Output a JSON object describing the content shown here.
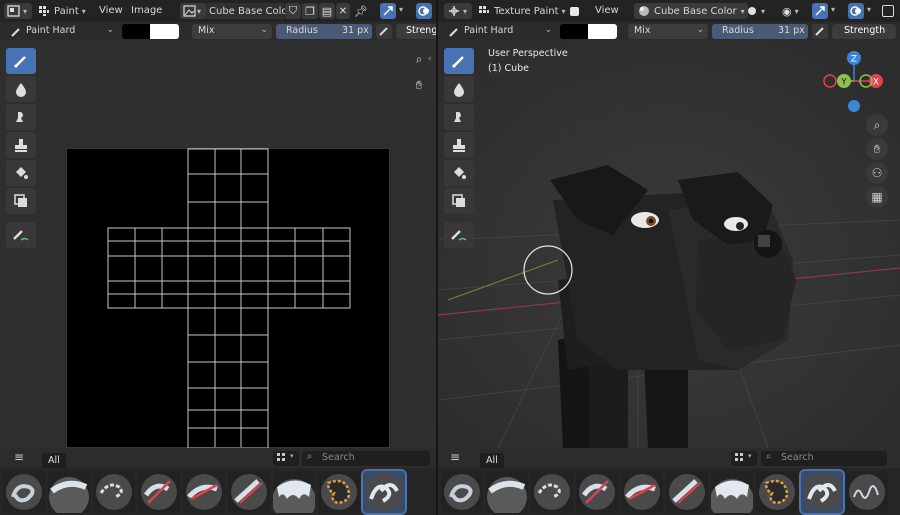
{
  "left_editor": {
    "header": {
      "mode_label": "Paint",
      "menus": [
        "View",
        "Image"
      ],
      "image_name": "Cube Base Color"
    },
    "tool_settings": {
      "brush_name": "Paint Hard",
      "blend_mode": "Mix",
      "radius_label": "Radius",
      "radius_value": "31 px",
      "strength_label": "Strength"
    },
    "shelf": {
      "tab_label": "All",
      "search_placeholder": "Search"
    }
  },
  "right_editor": {
    "header": {
      "mode_label": "Texture Paint",
      "menus": [
        "View"
      ],
      "image_name": "Cube Base Color"
    },
    "tool_settings": {
      "brush_name": "Paint Hard",
      "blend_mode": "Mix",
      "radius_label": "Radius",
      "radius_value": "31 px",
      "strength_label": "Strength"
    },
    "viewport": {
      "view_name": "User Perspective",
      "object_name": "(1) Cube"
    },
    "gizmo": {
      "z": "Z",
      "y": "Y",
      "x": "X"
    },
    "shelf": {
      "tab_label": "All",
      "search_placeholder": "Search"
    }
  },
  "colors": {
    "accent": "#4772b3",
    "primary_color": "#000000",
    "secondary_color": "#ffffff",
    "axis_x": "#e2404f",
    "axis_y": "#8bc34a",
    "axis_z": "#3d86d6"
  }
}
